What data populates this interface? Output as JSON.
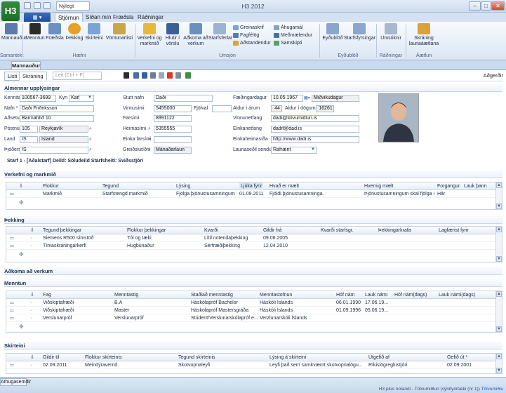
{
  "window": {
    "title": "H3 2012",
    "app_logo": "H3",
    "qat_combo": "Nýlegt"
  },
  "tabs": {
    "file": "▦ ▾",
    "items": [
      "Stjórnun",
      "Síðan mín",
      "Fræðsla",
      "Ráðningar"
    ],
    "active": "Stjórnun"
  },
  "ribbon": {
    "samantekt": {
      "buttons": [
        "Mannauður"
      ],
      "label": "Samantekt"
    },
    "haefni": {
      "buttons": [
        "Menntun",
        "Fræðsla",
        "Þekking",
        "Skírteini",
        "Vöntunarlisti"
      ],
      "label": "Hæfni"
    },
    "umsjon": {
      "big": [
        "Verkefni og markmið",
        "Hlutir í vörslu",
        "Aðkoma að verkum",
        "Starfsferlar"
      ],
      "small": [
        "Greinaskrif",
        "Fagfélög",
        "Aðstandendur",
        "Áhugamál",
        "Meðmælendur",
        "Samskipti"
      ],
      "label": "Umsjón"
    },
    "eydublod": {
      "buttons": [
        "Eyðublöð",
        "Starfsfyrsingar"
      ],
      "label": "Eyðublöð"
    },
    "radningar": {
      "buttons": [
        "Umsóknir"
      ],
      "label": "Ráðningar"
    },
    "aetlun": {
      "buttons": [
        "Skráning launaáætlana"
      ],
      "label": "Áætlun"
    }
  },
  "document_tab": "Mannauður",
  "subtabs": [
    "Listi",
    "Skráning"
  ],
  "search": {
    "placeholder": "Leit (Ctrl + F)"
  },
  "toolbar_right": "Aðgerðir",
  "general": {
    "heading": "Almennar upplýsingar",
    "kennitala": {
      "label": "Kennitala *",
      "value": "100567-3699"
    },
    "kyn": {
      "label": "Kyn",
      "value": "Karl"
    },
    "nafn": {
      "label": "Nafn *",
      "value": "Daði Friðriksson"
    },
    "adsetur": {
      "label": "Aðsetur",
      "value": "Barmahlíð 10"
    },
    "postnumer": {
      "label": "Póstnúmer",
      "code": "105",
      "city": "Reykjavík"
    },
    "land": {
      "label": "Land",
      "code": "IS",
      "name": "Ísland"
    },
    "thjoderni": {
      "label": "Þjóðerni",
      "value": "IS"
    },
    "stutt_nafn": {
      "label": "Stutt nafn",
      "value": "Daði"
    },
    "vinnusimi": {
      "label": "Vinnusími",
      "value": "5455000",
      "extra_label": "Fjölval"
    },
    "farsimi": {
      "label": "Farsími",
      "value": "8991122"
    },
    "heimasimi": {
      "label": "Heimasími",
      "value": "5355555"
    },
    "einka_farsimi": {
      "label": "Einka farsími",
      "value": ""
    },
    "greidslutidni": {
      "label": "Greiðslutíðni",
      "value": "Mánaðarlaun"
    },
    "faedingardagur": {
      "label": "Fæðingardagur",
      "value": "10.05.1967",
      "weekday": "Miðvikudagur"
    },
    "aldur": {
      "label": "Aldur í árum",
      "value": "44",
      "days_label": "Aldur í dögum",
      "days": "16261"
    },
    "vinnunetfang": {
      "label": "Vinnunetfang",
      "value": "dadi@tolvumidlun.is"
    },
    "einkanetfang": {
      "label": "Einkanetfang",
      "value": "dadif@dad.is"
    },
    "einkaheimasida": {
      "label": "Einkaheimasíða",
      "value": "http://www.dadi.is"
    },
    "launasedil": {
      "label": "Launaseðil sendur",
      "value": "Rafrænt"
    }
  },
  "starf_line": "Starf 1 - [Aðalstarf]  Deild: Söludeild  Starfsheiti: Sviðsstjóri",
  "verkefni": {
    "heading": "Verkefni og markmið",
    "columns": [
      "Flokkur",
      "Tegund",
      "Lýsing",
      "Ljúka fyrir",
      "Hvað er mælt",
      "Hvernig mælt",
      "Forgangur",
      "Lauk þann"
    ],
    "rows": [
      [
        "Markmið",
        "Starfstengd markmið",
        "Fjölga þjónustusamningum",
        "01.09.2011",
        "Fjöldi þjónustusamninga.",
        "Þjónustusamningum skal fjölga u...",
        "Hár",
        ""
      ]
    ]
  },
  "thekking": {
    "heading": "Þekking",
    "columns": [
      "Tegund þekkingar",
      "Flokkur þekkingar",
      "Kvarði",
      "Gildir frá",
      "Kvarði starfsgr.",
      "Þekkingarkrafa",
      "Lagfærist fyrir"
    ],
    "rows": [
      [
        "Siemens R500 símstöð",
        "Tól og tæki",
        "Lítil notendaþekking",
        "09.06.2005",
        "",
        "",
        ""
      ],
      [
        "Tímaskráningarkerfi",
        "Hugbúnaður",
        "Sérfræðiþekking",
        "12.04.2010",
        "",
        "",
        ""
      ]
    ]
  },
  "adkoma_heading": "Aðkoma að verkum",
  "menntun": {
    "heading": "Menntun",
    "columns": [
      "Fag",
      "Menntastig",
      "Staðlað menntastig",
      "Menntastofnun",
      "Hóf nám",
      "Lauk námi",
      "Hóf nám(dags)",
      "Lauk námi(dags)"
    ],
    "rows": [
      [
        "Viðskiptafræði",
        "B.A",
        "Háskólapróf Bachelor",
        "Háskóli Íslands",
        "06.01.1990",
        "17.06.19...",
        "",
        ""
      ],
      [
        "Viðskiptafræði",
        "Master",
        "Háskólapróf Mastersgráða",
        "Háskóli Íslands",
        "01.09.1996",
        "05.06.19...",
        "",
        ""
      ],
      [
        "Verslunarpróf",
        "Verslunarpróf",
        "Stúdent/Verslunarskólapróf e...",
        "Verzlunarskóli Íslands",
        "",
        "",
        "",
        ""
      ]
    ]
  },
  "skirteini": {
    "heading": "Skírteini",
    "columns": [
      "Gildir til",
      "Flokkur skírteinis",
      "Tegund skírteinis",
      "Lýsing á skírteini",
      "Útgefið af",
      "Gefið út *"
    ],
    "rows": [
      [
        "02.09.2011",
        "Meindýravernd",
        "Skotvopnaleyfi",
        "Leyfi það sem samkvæmt skotvopnalögu...",
        "Ríkislögreglustjóri",
        "02.09.2001"
      ]
    ]
  },
  "status": {
    "tab": "Athugasemdir",
    "text": "H3 plús notandi - Tölvumiðlun (sýnifyrirtæki (nr 1)) ",
    "link": "Tölvumiðlu"
  }
}
